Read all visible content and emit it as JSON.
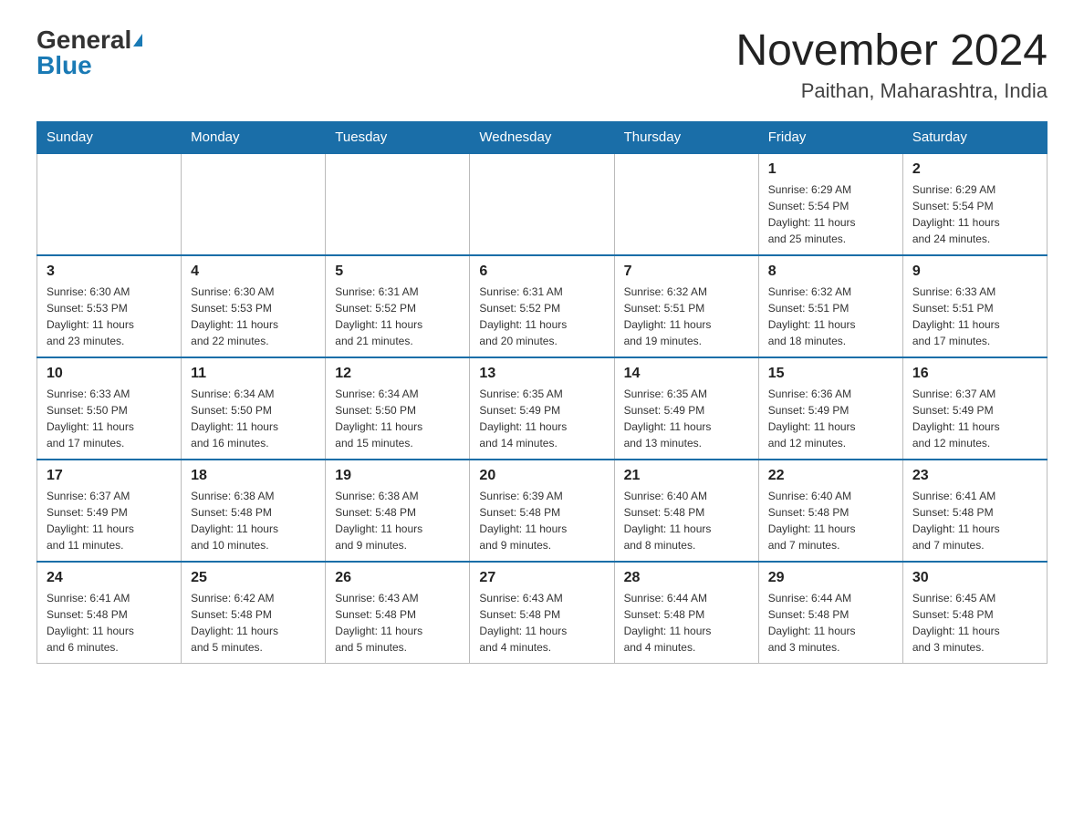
{
  "header": {
    "logo_general": "General",
    "logo_blue": "Blue",
    "month_title": "November 2024",
    "location": "Paithan, Maharashtra, India"
  },
  "weekdays": [
    "Sunday",
    "Monday",
    "Tuesday",
    "Wednesday",
    "Thursday",
    "Friday",
    "Saturday"
  ],
  "weeks": [
    [
      {
        "day": "",
        "info": ""
      },
      {
        "day": "",
        "info": ""
      },
      {
        "day": "",
        "info": ""
      },
      {
        "day": "",
        "info": ""
      },
      {
        "day": "",
        "info": ""
      },
      {
        "day": "1",
        "info": "Sunrise: 6:29 AM\nSunset: 5:54 PM\nDaylight: 11 hours\nand 25 minutes."
      },
      {
        "day": "2",
        "info": "Sunrise: 6:29 AM\nSunset: 5:54 PM\nDaylight: 11 hours\nand 24 minutes."
      }
    ],
    [
      {
        "day": "3",
        "info": "Sunrise: 6:30 AM\nSunset: 5:53 PM\nDaylight: 11 hours\nand 23 minutes."
      },
      {
        "day": "4",
        "info": "Sunrise: 6:30 AM\nSunset: 5:53 PM\nDaylight: 11 hours\nand 22 minutes."
      },
      {
        "day": "5",
        "info": "Sunrise: 6:31 AM\nSunset: 5:52 PM\nDaylight: 11 hours\nand 21 minutes."
      },
      {
        "day": "6",
        "info": "Sunrise: 6:31 AM\nSunset: 5:52 PM\nDaylight: 11 hours\nand 20 minutes."
      },
      {
        "day": "7",
        "info": "Sunrise: 6:32 AM\nSunset: 5:51 PM\nDaylight: 11 hours\nand 19 minutes."
      },
      {
        "day": "8",
        "info": "Sunrise: 6:32 AM\nSunset: 5:51 PM\nDaylight: 11 hours\nand 18 minutes."
      },
      {
        "day": "9",
        "info": "Sunrise: 6:33 AM\nSunset: 5:51 PM\nDaylight: 11 hours\nand 17 minutes."
      }
    ],
    [
      {
        "day": "10",
        "info": "Sunrise: 6:33 AM\nSunset: 5:50 PM\nDaylight: 11 hours\nand 17 minutes."
      },
      {
        "day": "11",
        "info": "Sunrise: 6:34 AM\nSunset: 5:50 PM\nDaylight: 11 hours\nand 16 minutes."
      },
      {
        "day": "12",
        "info": "Sunrise: 6:34 AM\nSunset: 5:50 PM\nDaylight: 11 hours\nand 15 minutes."
      },
      {
        "day": "13",
        "info": "Sunrise: 6:35 AM\nSunset: 5:49 PM\nDaylight: 11 hours\nand 14 minutes."
      },
      {
        "day": "14",
        "info": "Sunrise: 6:35 AM\nSunset: 5:49 PM\nDaylight: 11 hours\nand 13 minutes."
      },
      {
        "day": "15",
        "info": "Sunrise: 6:36 AM\nSunset: 5:49 PM\nDaylight: 11 hours\nand 12 minutes."
      },
      {
        "day": "16",
        "info": "Sunrise: 6:37 AM\nSunset: 5:49 PM\nDaylight: 11 hours\nand 12 minutes."
      }
    ],
    [
      {
        "day": "17",
        "info": "Sunrise: 6:37 AM\nSunset: 5:49 PM\nDaylight: 11 hours\nand 11 minutes."
      },
      {
        "day": "18",
        "info": "Sunrise: 6:38 AM\nSunset: 5:48 PM\nDaylight: 11 hours\nand 10 minutes."
      },
      {
        "day": "19",
        "info": "Sunrise: 6:38 AM\nSunset: 5:48 PM\nDaylight: 11 hours\nand 9 minutes."
      },
      {
        "day": "20",
        "info": "Sunrise: 6:39 AM\nSunset: 5:48 PM\nDaylight: 11 hours\nand 9 minutes."
      },
      {
        "day": "21",
        "info": "Sunrise: 6:40 AM\nSunset: 5:48 PM\nDaylight: 11 hours\nand 8 minutes."
      },
      {
        "day": "22",
        "info": "Sunrise: 6:40 AM\nSunset: 5:48 PM\nDaylight: 11 hours\nand 7 minutes."
      },
      {
        "day": "23",
        "info": "Sunrise: 6:41 AM\nSunset: 5:48 PM\nDaylight: 11 hours\nand 7 minutes."
      }
    ],
    [
      {
        "day": "24",
        "info": "Sunrise: 6:41 AM\nSunset: 5:48 PM\nDaylight: 11 hours\nand 6 minutes."
      },
      {
        "day": "25",
        "info": "Sunrise: 6:42 AM\nSunset: 5:48 PM\nDaylight: 11 hours\nand 5 minutes."
      },
      {
        "day": "26",
        "info": "Sunrise: 6:43 AM\nSunset: 5:48 PM\nDaylight: 11 hours\nand 5 minutes."
      },
      {
        "day": "27",
        "info": "Sunrise: 6:43 AM\nSunset: 5:48 PM\nDaylight: 11 hours\nand 4 minutes."
      },
      {
        "day": "28",
        "info": "Sunrise: 6:44 AM\nSunset: 5:48 PM\nDaylight: 11 hours\nand 4 minutes."
      },
      {
        "day": "29",
        "info": "Sunrise: 6:44 AM\nSunset: 5:48 PM\nDaylight: 11 hours\nand 3 minutes."
      },
      {
        "day": "30",
        "info": "Sunrise: 6:45 AM\nSunset: 5:48 PM\nDaylight: 11 hours\nand 3 minutes."
      }
    ]
  ]
}
